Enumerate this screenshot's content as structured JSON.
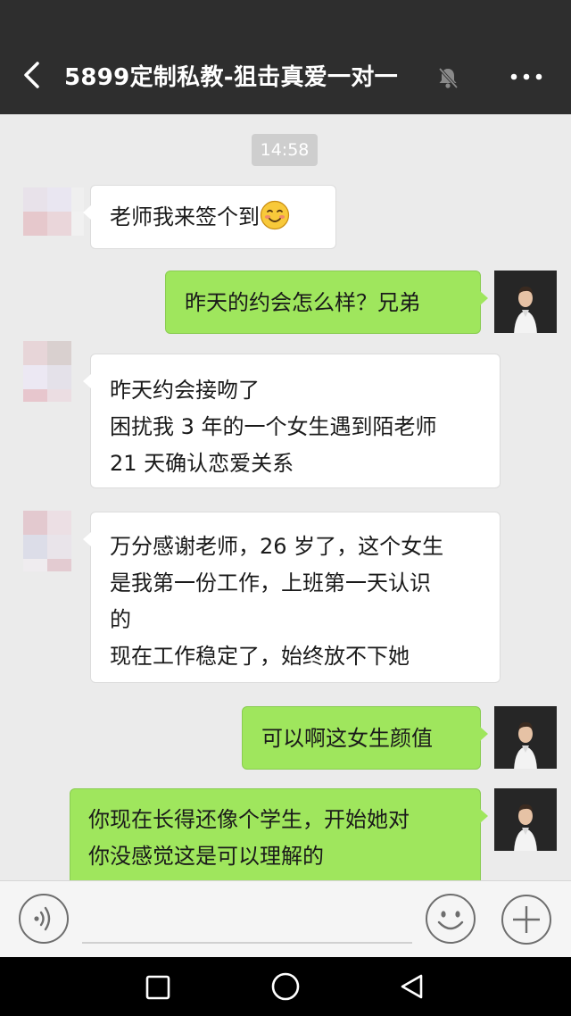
{
  "header": {
    "title": "5899定制私教-狙击真爱一对一",
    "back_icon": "chevron-left-icon",
    "mute_icon": "bell-off-icon",
    "more_icon": "more-dots-icon"
  },
  "chat": {
    "timestamp": "14:58",
    "messages": [
      {
        "side": "in",
        "lines": [
          "老师我来签个到"
        ],
        "emoji": "blushing-smile-emoji"
      },
      {
        "side": "out",
        "lines": [
          "昨天的约会怎么样？兄弟"
        ]
      },
      {
        "side": "in",
        "lines": [
          "昨天约会接吻了",
          "困扰我 3 年的一个女生遇到陌老师",
          "21 天确认恋爱关系"
        ]
      },
      {
        "side": "in",
        "lines": [
          "万分感谢老师，26 岁了，这个女生",
          "是我第一份工作，上班第一天认识",
          "的",
          "现在工作稳定了，始终放不下她"
        ]
      },
      {
        "side": "out",
        "lines": [
          "可以啊这女生颜值"
        ]
      },
      {
        "side": "out",
        "lines": [
          "你现在长得还像个学生，开始她对",
          "你没感觉这是可以理解的"
        ]
      }
    ]
  },
  "input_bar": {
    "voice_icon": "voice-icon",
    "input_value": "",
    "emoji_icon": "emoji-icon",
    "plus_icon": "plus-icon"
  },
  "nav_bar": {
    "recent_icon": "square-icon",
    "home_icon": "circle-icon",
    "back_icon": "triangle-back-icon"
  },
  "colors": {
    "header_bg": "#2e2e2e",
    "chat_bg": "#ebebeb",
    "bubble_out": "#9fe65d",
    "bubble_in": "#ffffff",
    "timestamp_bg": "#cecece"
  }
}
